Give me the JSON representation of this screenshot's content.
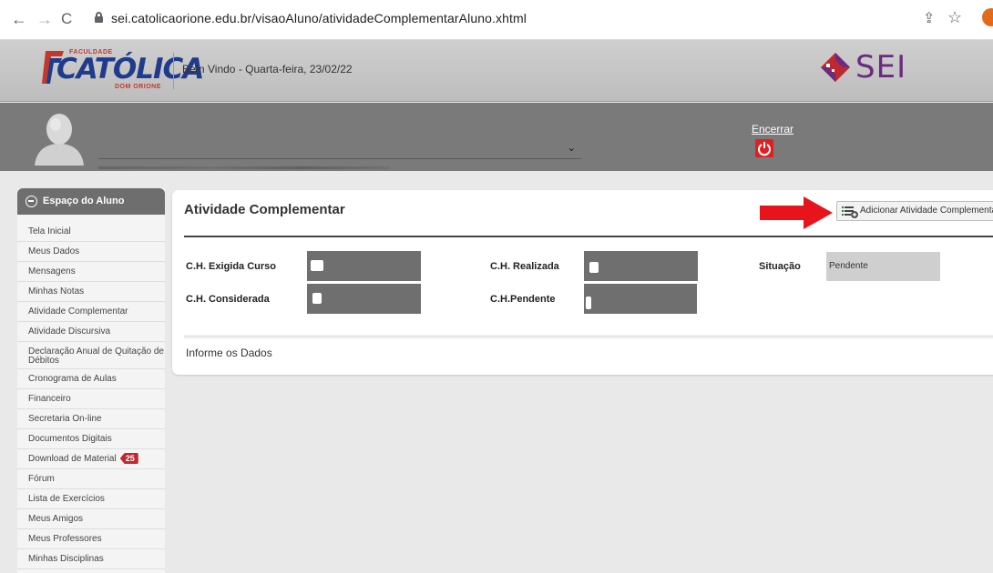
{
  "browser": {
    "back_icon": "←",
    "forward_icon": "→",
    "reload_icon": "C",
    "url": "sei.catolicaorione.edu.br/visaoAluno/atividadeComplementarAluno.xhtml",
    "share_icon": "⇪",
    "star_icon": "☆"
  },
  "header": {
    "logo_top": "FACULDADE",
    "logo_main": "CATÓLICA",
    "logo_bottom": "DOM ORIONE",
    "welcome": "Bem Vindo - Quarta-feira, 23/02/22",
    "sei_text": "SEI"
  },
  "user": {
    "encerrar": "Encerrar",
    "chevron": "⌄"
  },
  "sidebar": {
    "title": "Espaço do Aluno",
    "items": [
      {
        "label": "Tela Inicial"
      },
      {
        "label": "Meus Dados"
      },
      {
        "label": "Mensagens"
      },
      {
        "label": "Minhas Notas"
      },
      {
        "label": "Atividade Complementar"
      },
      {
        "label": "Atividade Discursiva"
      },
      {
        "label": "Declaração Anual de Quitação de Débitos"
      },
      {
        "label": "Cronograma de Aulas"
      },
      {
        "label": "Financeiro"
      },
      {
        "label": "Secretaria On-line"
      },
      {
        "label": "Documentos Digitais"
      },
      {
        "label": "Download de Material",
        "badge": "25"
      },
      {
        "label": "Fórum"
      },
      {
        "label": "Lista de Exercícios"
      },
      {
        "label": "Meus Amigos"
      },
      {
        "label": "Meus Professores"
      },
      {
        "label": "Minhas Disciplinas"
      }
    ]
  },
  "main": {
    "title": "Atividade Complementar",
    "add_button": "Adicionar Atividade Complementar",
    "fields": {
      "ch_exigida": "C.H. Exigida Curso",
      "ch_realizada": "C.H. Realizada",
      "situacao": "Situação",
      "situacao_value": "Pendente",
      "ch_considerada": "C.H. Considerada",
      "ch_pendente": "C.H.Pendente"
    },
    "informe": "Informe os Dados"
  },
  "colors": {
    "arrow": "#e8141c",
    "brand_blue": "#1f3b8c",
    "brand_red": "#c0392b",
    "sei_purple": "#6b2a80"
  }
}
